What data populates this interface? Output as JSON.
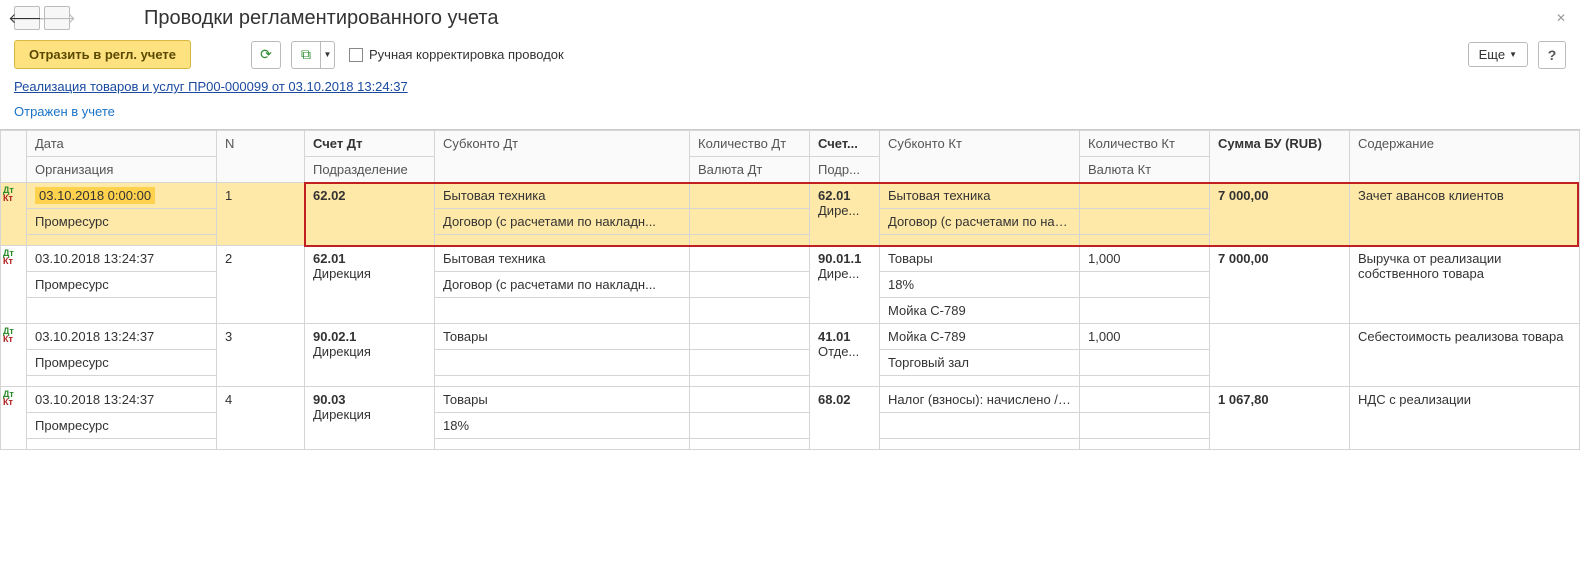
{
  "title": "Проводки регламентированного учета",
  "toolbar": {
    "reflect": "Отразить в регл. учете",
    "manual_label": "Ручная корректировка проводок",
    "more": "Еще",
    "help": "?"
  },
  "source_link": "Реализация товаров и услуг ПР00-000099 от 03.10.2018 13:24:37",
  "status": "Отражен в учете",
  "headers": {
    "date": "Дата",
    "n": "N",
    "acct_dt": "Счет Дт",
    "sub_dt": "Субконто Дт",
    "qty_dt": "Количество Дт",
    "acct_kt": "Счет...",
    "sub_kt": "Субконто Кт",
    "qty_kt": "Количество Кт",
    "sum": "Сумма БУ (RUB)",
    "desc": "Содержание",
    "org": "Организация",
    "dept": "Подразделение",
    "cur_dt": "Валюта Дт",
    "dept_kt": "Подр...",
    "cur_kt": "Валюта Кт"
  },
  "rows": [
    {
      "date": "03.10.2018 0:00:00",
      "n": "1",
      "org": "Промресурс",
      "acct_dt": "62.02",
      "dept": "",
      "sub_dt1": "Бытовая техника",
      "sub_dt2": "Договор (с расчетами по накладн...",
      "sub_dt3": "",
      "qty_dt": "",
      "cur_dt": "",
      "acct_kt": "62.01",
      "dept_kt": "Дире...",
      "sub_kt1": "Бытовая техника",
      "sub_kt2": "Договор (с расчетами по накла...",
      "sub_kt3": "",
      "qty_kt": "",
      "cur_kt": "",
      "sum": "7 000,00",
      "desc": "Зачет авансов клиентов",
      "selected": true
    },
    {
      "date": "03.10.2018 13:24:37",
      "n": "2",
      "org": "Промресурс",
      "acct_dt": "62.01",
      "dept": "Дирекция",
      "sub_dt1": "Бытовая техника",
      "sub_dt2": "Договор (с расчетами по накладн...",
      "sub_dt3": "",
      "qty_dt": "",
      "cur_dt": "",
      "acct_kt": "90.01.1",
      "dept_kt": "Дире...",
      "sub_kt1": "Товары",
      "sub_kt2": "18%",
      "sub_kt3": "Мойка С-789",
      "qty_kt": "1,000",
      "cur_kt": "",
      "sum": "7 000,00",
      "desc": "Выручка от реализации собственного товара",
      "selected": false
    },
    {
      "date": "03.10.2018 13:24:37",
      "n": "3",
      "org": "Промресурс",
      "acct_dt": "90.02.1",
      "dept": "Дирекция",
      "sub_dt1": "Товары",
      "sub_dt2": "",
      "sub_dt3": "",
      "qty_dt": "",
      "cur_dt": "",
      "acct_kt": "41.01",
      "dept_kt": "Отде...",
      "sub_kt1": "Мойка С-789",
      "sub_kt2": "Торговый зал",
      "sub_kt3": "",
      "qty_kt": "1,000",
      "cur_kt": "",
      "sum": "",
      "desc": "Себестоимость реализова товара",
      "selected": false
    },
    {
      "date": "03.10.2018 13:24:37",
      "n": "4",
      "org": "Промресурс",
      "acct_dt": "90.03",
      "dept": "Дирекция",
      "sub_dt1": "Товары",
      "sub_dt2": "18%",
      "sub_dt3": "",
      "qty_dt": "",
      "cur_dt": "",
      "acct_kt": "68.02",
      "dept_kt": "",
      "sub_kt1": "Налог (взносы): начислено / уп...",
      "sub_kt2": "",
      "sub_kt3": "",
      "qty_kt": "",
      "cur_kt": "",
      "sum": "1 067,80",
      "desc": "НДС с реализации",
      "selected": false
    }
  ]
}
